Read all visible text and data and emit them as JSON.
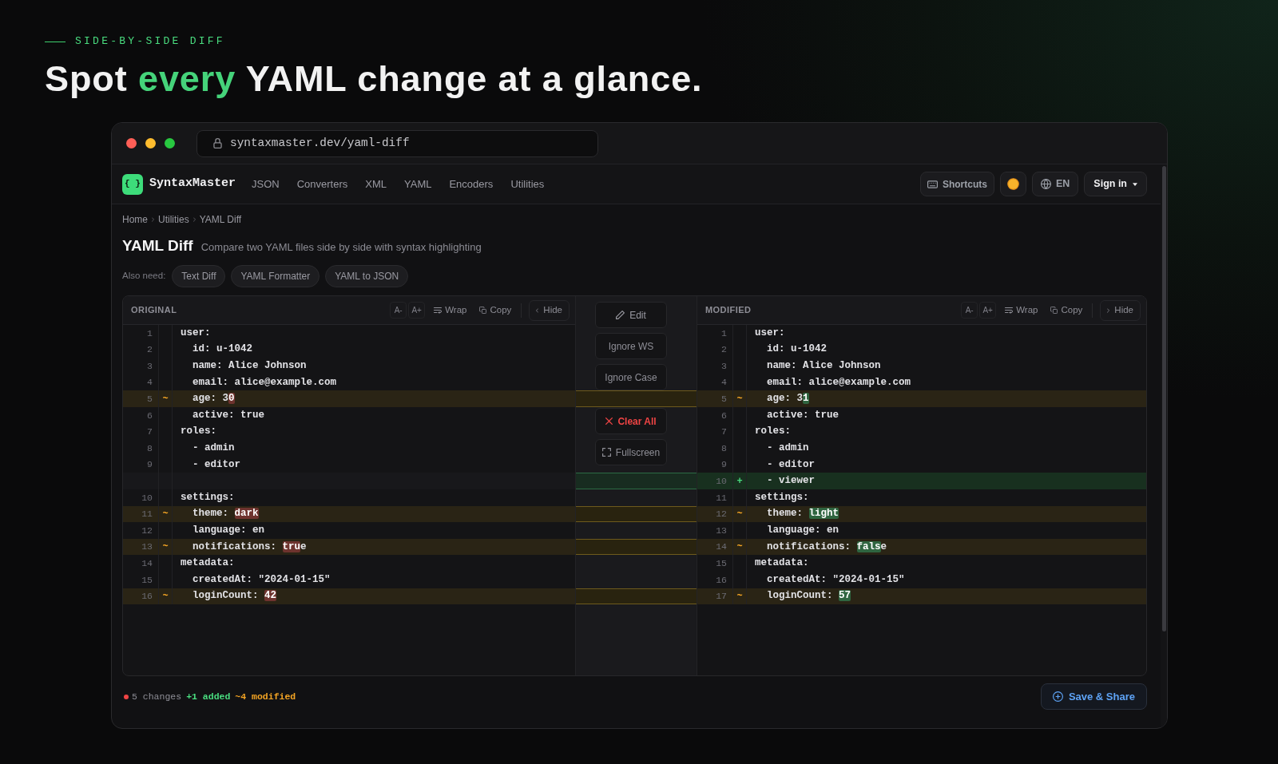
{
  "hero": {
    "eyebrow": "SIDE-BY-SIDE DIFF",
    "headline": [
      {
        "text": "Spot",
        "accent": false
      },
      {
        "text": "every",
        "accent": true
      },
      {
        "text": "YAML change at a glance.",
        "accent": false
      }
    ]
  },
  "browser": {
    "url": "syntaxmaster.dev/yaml-diff"
  },
  "nav": {
    "logo": "{ }",
    "brand": "SyntaxMaster",
    "links": [
      {
        "label": "JSON",
        "selected": false
      },
      {
        "label": "Converters",
        "selected": false
      },
      {
        "label": "XML",
        "selected": false
      },
      {
        "label": "YAML",
        "selected": false
      },
      {
        "label": "Encoders",
        "selected": false
      },
      {
        "label": "Utilities",
        "selected": false
      }
    ],
    "actions": [
      {
        "kind": "shortcuts",
        "label": "Shortcuts"
      },
      {
        "kind": "theme"
      },
      {
        "kind": "language",
        "label": "EN"
      },
      {
        "kind": "account",
        "label": "Sign in"
      }
    ]
  },
  "breadcrumb": [
    "Home",
    "Utilities",
    "YAML Diff"
  ],
  "page": {
    "title": "YAML Diff",
    "subtitle": "Compare two YAML files side by side with syntax highlighting"
  },
  "related": {
    "label": "Also need:",
    "links": [
      "Text Diff",
      "YAML Formatter",
      "YAML to JSON"
    ]
  },
  "panes": [
    {
      "title": "ORIGINAL",
      "kind": "before",
      "tools": [
        {
          "kind": "font_smaller",
          "label": "A-"
        },
        {
          "kind": "font_larger",
          "label": "A+"
        },
        {
          "kind": "wrap",
          "label": "Wrap"
        },
        {
          "kind": "copy",
          "label": "Copy"
        },
        {
          "kind": "hide_left",
          "label": "Hide"
        }
      ],
      "lines": [
        {
          "number": "1",
          "kind": "plain",
          "code": "user:"
        },
        {
          "number": "2",
          "kind": "plain",
          "code": "  id: u-1042"
        },
        {
          "number": "3",
          "kind": "plain",
          "code": "  name: Alice Johnson"
        },
        {
          "number": "4",
          "kind": "plain",
          "code": "  email: alice@example.com"
        },
        {
          "number": "5",
          "kind": "modified",
          "marker": "~",
          "parts": [
            {
              "text": "  age: 3",
              "changed": false
            },
            {
              "text": "0",
              "changed": true
            }
          ]
        },
        {
          "number": "6",
          "kind": "plain",
          "code": "  active: true"
        },
        {
          "number": "7",
          "kind": "plain",
          "code": "roles:"
        },
        {
          "number": "8",
          "kind": "plain",
          "code": "  - admin"
        },
        {
          "number": "9",
          "kind": "plain",
          "code": "  - editor"
        },
        {
          "kind": "blank"
        },
        {
          "number": "10",
          "kind": "plain",
          "code": "settings:"
        },
        {
          "number": "11",
          "kind": "modified",
          "marker": "~",
          "parts": [
            {
              "text": "  theme: ",
              "changed": false
            },
            {
              "text": "dark",
              "changed": true
            }
          ]
        },
        {
          "number": "12",
          "kind": "plain",
          "code": "  language: en"
        },
        {
          "number": "13",
          "kind": "modified",
          "marker": "~",
          "parts": [
            {
              "text": "  notifications: ",
              "changed": false
            },
            {
              "text": "tru",
              "changed": true
            },
            {
              "text": "e",
              "changed": false
            }
          ]
        },
        {
          "number": "14",
          "kind": "plain",
          "code": "metadata:"
        },
        {
          "number": "15",
          "kind": "plain",
          "code": "  createdAt: \"2024-01-15\""
        },
        {
          "number": "16",
          "kind": "modified",
          "marker": "~",
          "parts": [
            {
              "text": "  loginCount: ",
              "changed": false
            },
            {
              "text": "42",
              "changed": true
            }
          ]
        }
      ]
    },
    {
      "title": "MODIFIED",
      "kind": "after",
      "tools": [
        {
          "kind": "font_smaller",
          "label": "A-"
        },
        {
          "kind": "font_larger",
          "label": "A+"
        },
        {
          "kind": "wrap",
          "label": "Wrap"
        },
        {
          "kind": "copy",
          "label": "Copy"
        },
        {
          "kind": "hide_right",
          "label": "Hide"
        }
      ],
      "lines": [
        {
          "number": "1",
          "kind": "plain",
          "code": "user:"
        },
        {
          "number": "2",
          "kind": "plain",
          "code": "  id: u-1042"
        },
        {
          "number": "3",
          "kind": "plain",
          "code": "  name: Alice Johnson"
        },
        {
          "number": "4",
          "kind": "plain",
          "code": "  email: alice@example.com"
        },
        {
          "number": "5",
          "kind": "modified",
          "marker": "~",
          "parts": [
            {
              "text": "  age: 3",
              "changed": false
            },
            {
              "text": "1",
              "changed": true
            }
          ]
        },
        {
          "number": "6",
          "kind": "plain",
          "code": "  active: true"
        },
        {
          "number": "7",
          "kind": "plain",
          "code": "roles:"
        },
        {
          "number": "8",
          "kind": "plain",
          "code": "  - admin"
        },
        {
          "number": "9",
          "kind": "plain",
          "code": "  - editor"
        },
        {
          "number": "10",
          "kind": "added",
          "marker": "+",
          "code": "  - viewer"
        },
        {
          "number": "11",
          "kind": "plain",
          "code": "settings:"
        },
        {
          "number": "12",
          "kind": "modified",
          "marker": "~",
          "parts": [
            {
              "text": "  theme: ",
              "changed": false
            },
            {
              "text": "light",
              "changed": true
            }
          ]
        },
        {
          "number": "13",
          "kind": "plain",
          "code": "  language: en"
        },
        {
          "number": "14",
          "kind": "modified",
          "marker": "~",
          "parts": [
            {
              "text": "  notifications: ",
              "changed": false
            },
            {
              "text": "fals",
              "changed": true
            },
            {
              "text": "e",
              "changed": false
            }
          ]
        },
        {
          "number": "15",
          "kind": "plain",
          "code": "metadata:"
        },
        {
          "number": "16",
          "kind": "plain",
          "code": "  createdAt: \"2024-01-15\""
        },
        {
          "number": "17",
          "kind": "modified",
          "marker": "~",
          "parts": [
            {
              "text": "  loginCount: ",
              "changed": false
            },
            {
              "text": "57",
              "changed": true
            }
          ]
        }
      ]
    }
  ],
  "controls": [
    {
      "kind": "edit",
      "label": "Edit"
    },
    {
      "kind": "toggle",
      "label": "Ignore WS",
      "on": false
    },
    {
      "kind": "toggle",
      "label": "Ignore Case",
      "on": false
    },
    {
      "kind": "danger",
      "label": "Clear All"
    },
    {
      "kind": "fullscreen",
      "label": "Fullscreen"
    }
  ],
  "footer": {
    "summary": [
      {
        "kind": "total",
        "text": "5 changes"
      },
      {
        "kind": "added",
        "text": "+1 added"
      },
      {
        "kind": "modified",
        "text": "~4 modified"
      }
    ],
    "button": "Save & Share"
  }
}
